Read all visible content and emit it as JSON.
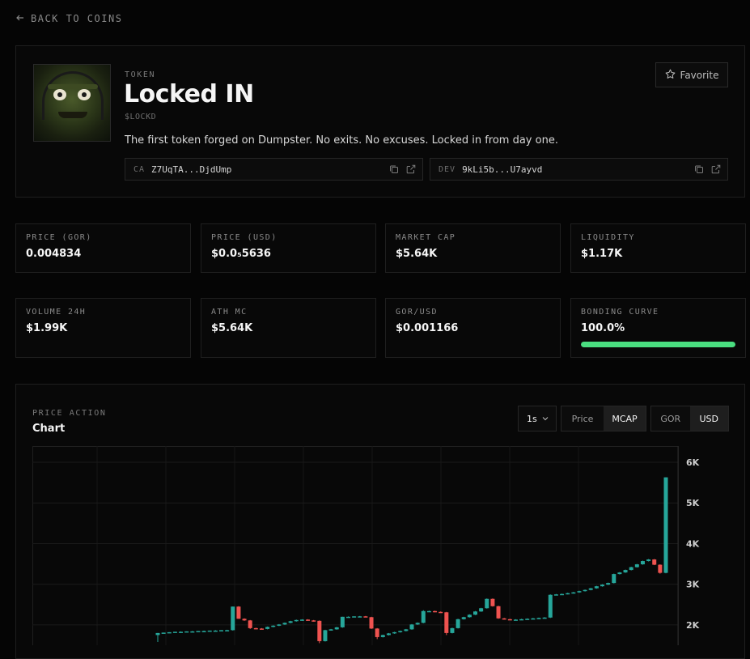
{
  "nav": {
    "back_label": "BACK TO COINS"
  },
  "token": {
    "section_label": "TOKEN",
    "name": "Locked IN",
    "ticker": "$LOCKD",
    "description": "The first token forged on Dumpster. No exits. No excuses. Locked in from day one.",
    "favorite_label": "Favorite",
    "ca": {
      "key": "CA",
      "value": "Z7UqTA...DjdUmp"
    },
    "dev": {
      "key": "DEV",
      "value": "9kLi5b...U7ayvd"
    }
  },
  "stats_row1": [
    {
      "label": "PRICE (GOR)",
      "value": "0.004834"
    },
    {
      "label": "PRICE (USD)",
      "value": "$0.0₅5636"
    },
    {
      "label": "MARKET CAP",
      "value": "$5.64K"
    },
    {
      "label": "LIQUIDITY",
      "value": "$1.17K"
    }
  ],
  "stats_row2": [
    {
      "label": "VOLUME 24H",
      "value": "$1.99K"
    },
    {
      "label": "ATH MC",
      "value": "$5.64K"
    },
    {
      "label": "GOR/USD",
      "value": "$0.001166"
    },
    {
      "label": "BONDING CURVE",
      "value": "100.0%",
      "progress": 1.0
    }
  ],
  "chart_section": {
    "label": "PRICE ACTION",
    "title": "Chart",
    "interval": "1s",
    "type_options": [
      "Price",
      "MCAP"
    ],
    "type_selected": "MCAP",
    "currency_options": [
      "GOR",
      "USD"
    ],
    "currency_selected": "USD"
  },
  "colors": {
    "up": "#26a69a",
    "down": "#ef5350",
    "accent": "#4ade80"
  },
  "chart_data": {
    "type": "candlestick",
    "ylabels": [
      "6K",
      "5K",
      "4K",
      "3K",
      "2K"
    ],
    "yticks": [
      6000,
      5000,
      4000,
      3000,
      2000
    ],
    "ylim": [
      1300,
      6200
    ],
    "candles": [
      [
        1750,
        1800,
        1580,
        1800
      ],
      [
        1800,
        1810,
        1790,
        1810
      ],
      [
        1810,
        1820,
        1800,
        1820
      ],
      [
        1820,
        1830,
        1810,
        1830
      ],
      [
        1830,
        1840,
        1820,
        1830
      ],
      [
        1830,
        1840,
        1820,
        1840
      ],
      [
        1840,
        1850,
        1830,
        1840
      ],
      [
        1840,
        1850,
        1830,
        1850
      ],
      [
        1850,
        1860,
        1840,
        1850
      ],
      [
        1850,
        1860,
        1840,
        1860
      ],
      [
        1860,
        1870,
        1850,
        1860
      ],
      [
        1860,
        1870,
        1850,
        1870
      ],
      [
        1870,
        1880,
        1860,
        1870
      ],
      [
        1870,
        2450,
        1860,
        2450
      ],
      [
        2450,
        2460,
        2150,
        2150
      ],
      [
        2150,
        2160,
        2100,
        2110
      ],
      [
        2110,
        2120,
        1900,
        1920
      ],
      [
        1920,
        1930,
        1890,
        1910
      ],
      [
        1910,
        1920,
        1890,
        1900
      ],
      [
        1900,
        1960,
        1890,
        1950
      ],
      [
        1950,
        1990,
        1940,
        1980
      ],
      [
        1980,
        2020,
        1970,
        2010
      ],
      [
        2010,
        2060,
        2000,
        2050
      ],
      [
        2050,
        2100,
        2040,
        2090
      ],
      [
        2090,
        2130,
        2080,
        2120
      ],
      [
        2120,
        2140,
        2100,
        2130
      ],
      [
        2130,
        2140,
        2100,
        2110
      ],
      [
        2110,
        2120,
        2080,
        2100
      ],
      [
        2100,
        2110,
        1550,
        1600
      ],
      [
        1600,
        1880,
        1590,
        1870
      ],
      [
        1870,
        1900,
        1860,
        1890
      ],
      [
        1890,
        1950,
        1880,
        1940
      ],
      [
        1940,
        2200,
        1930,
        2200
      ],
      [
        2200,
        2210,
        2190,
        2200
      ],
      [
        2200,
        2210,
        2190,
        2210
      ],
      [
        2210,
        2220,
        2200,
        2210
      ],
      [
        2210,
        2220,
        2190,
        2190
      ],
      [
        2190,
        2200,
        1900,
        1910
      ],
      [
        1910,
        1920,
        1650,
        1700
      ],
      [
        1700,
        1760,
        1690,
        1750
      ],
      [
        1750,
        1800,
        1740,
        1790
      ],
      [
        1790,
        1830,
        1780,
        1820
      ],
      [
        1820,
        1860,
        1810,
        1850
      ],
      [
        1850,
        1900,
        1840,
        1890
      ],
      [
        1890,
        2020,
        1880,
        2010
      ],
      [
        2010,
        2060,
        2000,
        2050
      ],
      [
        2050,
        2360,
        2040,
        2340
      ],
      [
        2340,
        2350,
        2330,
        2340
      ],
      [
        2340,
        2350,
        2310,
        2320
      ],
      [
        2320,
        2330,
        2300,
        2310
      ],
      [
        2310,
        2320,
        1750,
        1800
      ],
      [
        1800,
        1930,
        1790,
        1920
      ],
      [
        1920,
        2150,
        1910,
        2140
      ],
      [
        2140,
        2200,
        2130,
        2190
      ],
      [
        2190,
        2260,
        2180,
        2250
      ],
      [
        2250,
        2340,
        2240,
        2330
      ],
      [
        2330,
        2420,
        2320,
        2410
      ],
      [
        2410,
        2650,
        2400,
        2640
      ],
      [
        2640,
        2650,
        2450,
        2460
      ],
      [
        2460,
        2470,
        2150,
        2160
      ],
      [
        2160,
        2170,
        2130,
        2140
      ],
      [
        2140,
        2150,
        2120,
        2130
      ],
      [
        2130,
        2140,
        2110,
        2130
      ],
      [
        2130,
        2150,
        2120,
        2140
      ],
      [
        2140,
        2160,
        2130,
        2150
      ],
      [
        2150,
        2170,
        2140,
        2160
      ],
      [
        2160,
        2180,
        2150,
        2170
      ],
      [
        2170,
        2190,
        2160,
        2180
      ],
      [
        2180,
        2750,
        2170,
        2740
      ],
      [
        2740,
        2760,
        2730,
        2750
      ],
      [
        2750,
        2770,
        2740,
        2760
      ],
      [
        2760,
        2790,
        2750,
        2780
      ],
      [
        2780,
        2810,
        2770,
        2800
      ],
      [
        2800,
        2840,
        2790,
        2830
      ],
      [
        2830,
        2870,
        2820,
        2860
      ],
      [
        2860,
        2910,
        2850,
        2900
      ],
      [
        2900,
        2960,
        2890,
        2950
      ],
      [
        2950,
        3000,
        2940,
        2990
      ],
      [
        2990,
        3040,
        2980,
        3030
      ],
      [
        3030,
        3260,
        3020,
        3250
      ],
      [
        3250,
        3300,
        3240,
        3290
      ],
      [
        3290,
        3360,
        3280,
        3350
      ],
      [
        3350,
        3430,
        3340,
        3420
      ],
      [
        3420,
        3500,
        3410,
        3490
      ],
      [
        3490,
        3580,
        3480,
        3570
      ],
      [
        3570,
        3620,
        3560,
        3610
      ],
      [
        3610,
        3620,
        3470,
        3480
      ],
      [
        3480,
        3490,
        3260,
        3280
      ],
      [
        3280,
        5630,
        3270,
        5630
      ]
    ]
  }
}
